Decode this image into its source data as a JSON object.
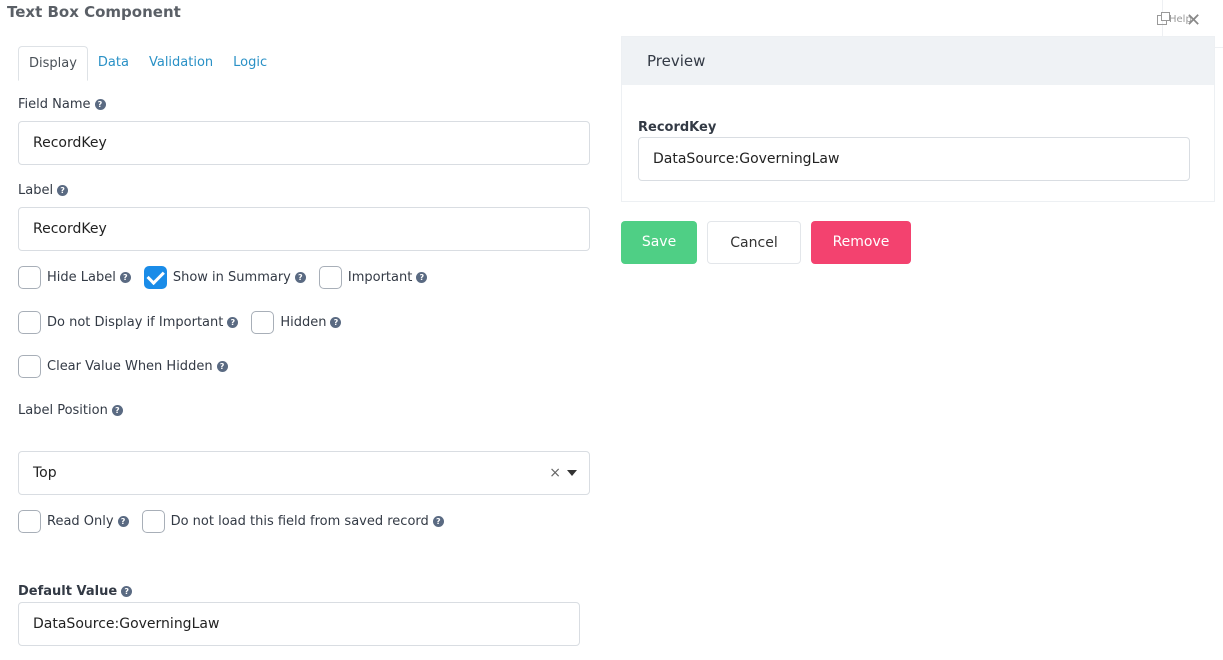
{
  "header": {
    "title": "Text Box Component"
  },
  "corner": {
    "help_label": "Help"
  },
  "tabs": [
    {
      "label": "Display"
    },
    {
      "label": "Data"
    },
    {
      "label": "Validation"
    },
    {
      "label": "Logic"
    }
  ],
  "form": {
    "field_name_label": "Field Name",
    "field_name_value": "RecordKey",
    "label_label": "Label",
    "label_value": "RecordKey",
    "checks": {
      "hide_label": {
        "label": "Hide Label",
        "checked": false
      },
      "show_in_summary": {
        "label": "Show in Summary",
        "checked": true
      },
      "important": {
        "label": "Important",
        "checked": false
      },
      "do_not_display": {
        "label": "Do not Display if Important",
        "checked": false
      },
      "hidden": {
        "label": "Hidden",
        "checked": false
      },
      "clear_value": {
        "label": "Clear Value When Hidden",
        "checked": false
      },
      "read_only": {
        "label": "Read Only",
        "checked": false
      },
      "do_not_load": {
        "label": "Do not load this field from saved record",
        "checked": false
      }
    },
    "label_position_label": "Label Position",
    "label_position_value": "Top",
    "default_value_label": "Default Value",
    "default_value": "DataSource:GoverningLaw"
  },
  "preview": {
    "title": "Preview",
    "field_label": "RecordKey",
    "field_value": "DataSource:GoverningLaw"
  },
  "buttons": {
    "save": "Save",
    "cancel": "Cancel",
    "remove": "Remove"
  },
  "colors": {
    "accent": "#2a91c6",
    "save": "#4fcf85",
    "remove": "#f3426f",
    "checked": "#1a8ce8"
  }
}
